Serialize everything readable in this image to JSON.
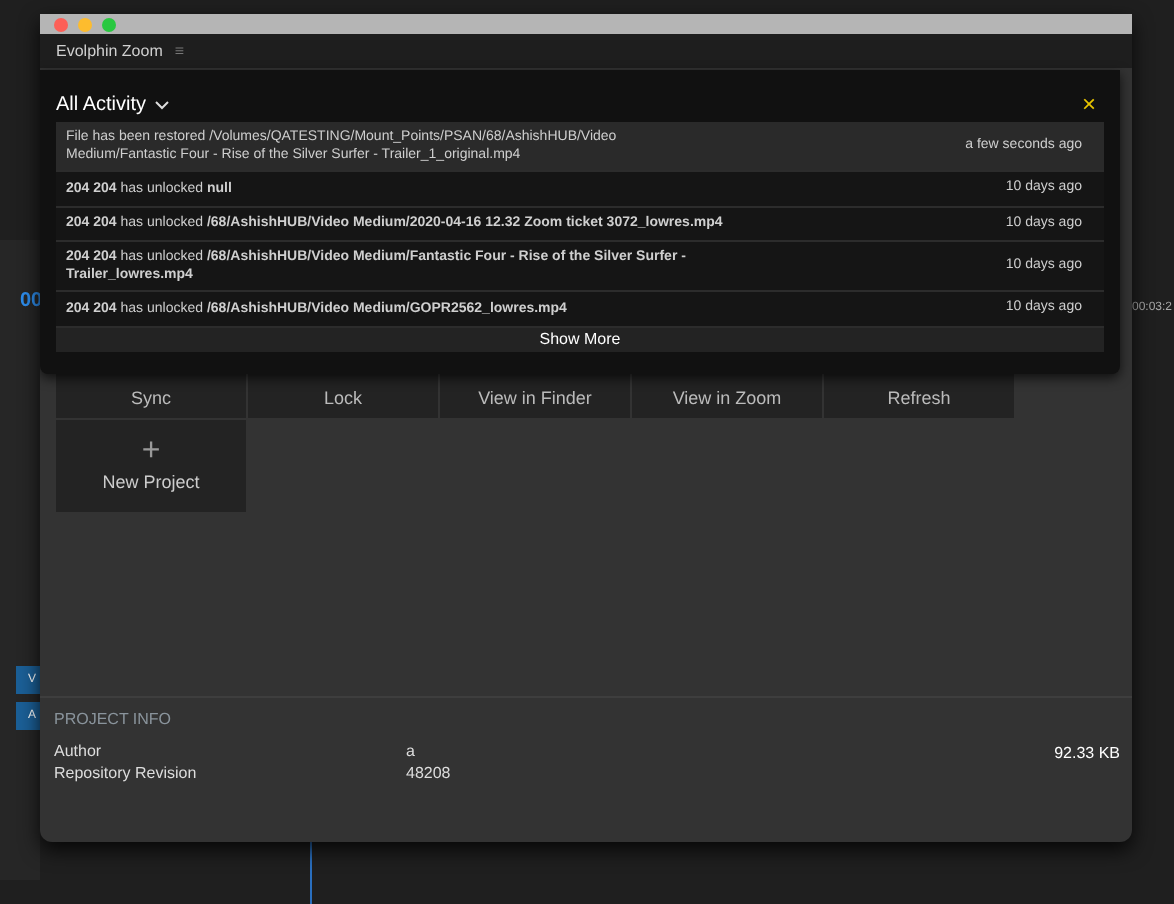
{
  "background": {
    "timecode": "00",
    "track_tags": [
      "V",
      "A"
    ],
    "timeline_time": "00:03:2"
  },
  "window": {
    "title": "Evolphin Zoom",
    "menu_icon": "≡"
  },
  "activity": {
    "filter": "All Activity",
    "close": "×",
    "items": [
      {
        "text": "File has been restored  /Volumes/QATESTING/Mount_Points/PSAN/68/AshishHUB/Video Medium/Fantastic Four - Rise of the Silver Surfer - Trailer_1_original.mp4",
        "time": "a few seconds ago",
        "unread": true
      },
      {
        "text": "**204 204** has unlocked **null**",
        "time": "10 days ago",
        "unread": false
      },
      {
        "text": "**204 204** has unlocked **/68/AshishHUB/Video Medium/2020-04-16 12.32 Zoom ticket 3072_lowres.mp4**",
        "time": "10 days ago",
        "unread": false
      },
      {
        "text": "**204 204** has unlocked **/68/AshishHUB/Video Medium/Fantastic Four - Rise of the Silver Surfer - Trailer_lowres.mp4**",
        "time": "10 days ago",
        "unread": false
      },
      {
        "text": "**204 204** has unlocked **/68/AshishHUB/Video Medium/GOPR2562_lowres.mp4**",
        "time": "10 days ago",
        "unread": false
      }
    ],
    "show_more": "Show More"
  },
  "actions": [
    "Sync",
    "Lock",
    "View in Finder",
    "View in Zoom",
    "Refresh"
  ],
  "new_project": {
    "icon": "+",
    "label": "New Project"
  },
  "project_info": {
    "heading": "PROJECT INFO",
    "fields": [
      {
        "label": "Author",
        "value": "a"
      },
      {
        "label": "Repository Revision",
        "value": "48208"
      }
    ],
    "size": "92.33 KB"
  }
}
